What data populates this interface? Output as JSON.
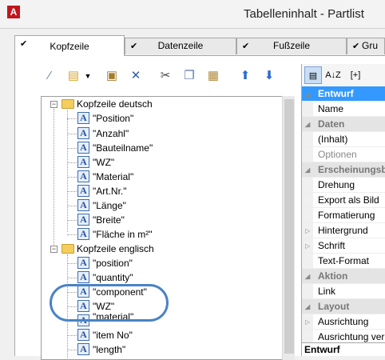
{
  "window": {
    "title": "Tabelleninhalt - Partlist",
    "app_icon": "autocad-icon"
  },
  "tabs": [
    {
      "label": "Kopfzeile",
      "checked": true,
      "active": true
    },
    {
      "label": "Datenzeile",
      "checked": true,
      "active": false
    },
    {
      "label": "Fußzeile",
      "checked": true,
      "active": false
    },
    {
      "label": "Gru",
      "checked": true,
      "active": false
    }
  ],
  "toolbar": {
    "icons": [
      "magic-wand-icon",
      "new-item-icon",
      "dropdown-arrow-icon",
      "properties-icon",
      "delete-icon",
      "cut-icon",
      "copy-icon",
      "paste-icon",
      "move-up-icon",
      "move-down-icon"
    ]
  },
  "tree": {
    "groups": [
      {
        "label": "Kopfzeile deutsch",
        "expanded": true,
        "items": [
          "\"Position\"",
          "\"Anzahl\"",
          "\"Bauteilname\"",
          "\"WZ\"",
          "\"Material\"",
          "\"Art.Nr.\"",
          "\"Länge\"",
          "\"Breite\"",
          "\"Fläche in m²\""
        ]
      },
      {
        "label": "Kopfzeile englisch",
        "expanded": true,
        "items": [
          "\"position\"",
          "\"quantity\"",
          "\"component\"",
          "\"WZ\"",
          "\"material\"",
          "\"item No\"",
          "\"length\""
        ]
      }
    ],
    "field_icon_glyph": "A",
    "highlighted_item": "\"WZ\"",
    "highlight_color": "#4a83c4"
  },
  "properties": {
    "toolbar": {
      "categorized": "categorized-icon",
      "alphabetic": "sort-az-icon",
      "alphabetic_label": "A↓Z",
      "expand_label": "[+]"
    },
    "rows": [
      {
        "type": "category",
        "label": "Entwurf",
        "selected": true
      },
      {
        "type": "prop",
        "label": "Name"
      },
      {
        "type": "category",
        "label": "Daten"
      },
      {
        "type": "prop",
        "label": "(Inhalt)"
      },
      {
        "type": "prop",
        "label": "Optionen",
        "disabled": true
      },
      {
        "type": "category",
        "label": "Erscheinungsbild"
      },
      {
        "type": "prop",
        "label": "Drehung"
      },
      {
        "type": "prop",
        "label": "Export als Bild"
      },
      {
        "type": "prop",
        "label": "Formatierung"
      },
      {
        "type": "prop",
        "label": "Hintergrund",
        "expandable": true
      },
      {
        "type": "prop",
        "label": "Schrift",
        "expandable": true
      },
      {
        "type": "prop",
        "label": "Text-Format"
      },
      {
        "type": "category",
        "label": "Aktion"
      },
      {
        "type": "prop",
        "label": "Link"
      },
      {
        "type": "category",
        "label": "Layout"
      },
      {
        "type": "prop",
        "label": "Ausrichtung",
        "expandable": true
      },
      {
        "type": "prop",
        "label": "Ausrichtung ver"
      }
    ],
    "footer": "Entwurf",
    "selected_color": "#3399ff"
  }
}
